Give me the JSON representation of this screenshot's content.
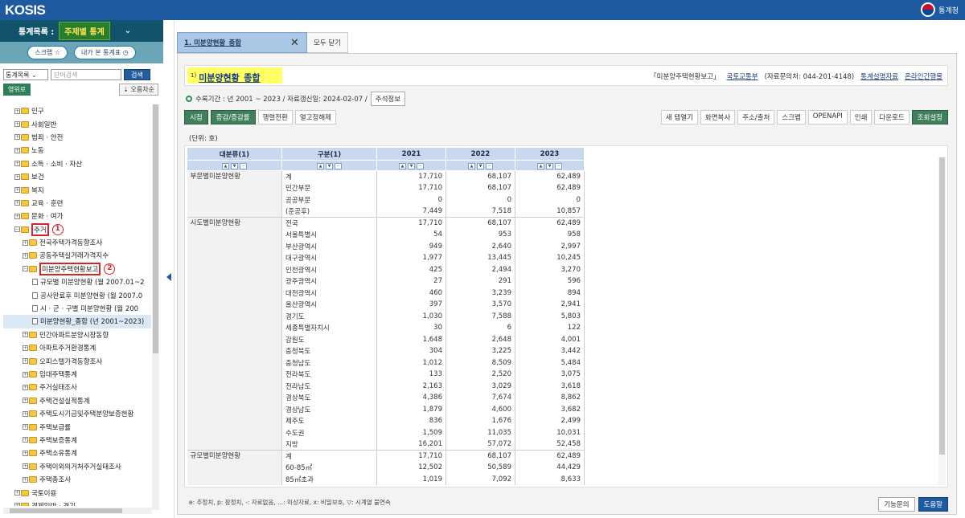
{
  "header": {
    "logo": "KOSIS",
    "org": "통계청"
  },
  "left": {
    "list_label": "통계목록 :",
    "list_select": "주제별 통계",
    "scrap": "스크랩 ☆",
    "my_table": "내가 본 통계표 ◷",
    "search_select": "통계목록",
    "search_placeholder": "단어검색",
    "search_btn": "검색",
    "roman": "영위로",
    "sort": "오름차순",
    "tree": [
      {
        "t": "인구",
        "lvl": 1
      },
      {
        "t": "사회일반",
        "lvl": 1
      },
      {
        "t": "범죄 · 안전",
        "lvl": 1
      },
      {
        "t": "노동",
        "lvl": 1
      },
      {
        "t": "소득 · 소비 · 자산",
        "lvl": 1
      },
      {
        "t": "보건",
        "lvl": 1
      },
      {
        "t": "복지",
        "lvl": 1
      },
      {
        "t": "교육 · 훈련",
        "lvl": 1
      },
      {
        "t": "문화 · 여가",
        "lvl": 1
      },
      {
        "t": "주거",
        "lvl": 1,
        "hl": "1"
      },
      {
        "t": "전국주택가격동향조사",
        "lvl": 2
      },
      {
        "t": "공동주택실거래가격지수",
        "lvl": 2
      },
      {
        "t": "미분양주택현황보고",
        "lvl": 2,
        "hl": "2"
      },
      {
        "t": "규모별 미분양현황 (월 2007.01~2",
        "lvl": 3,
        "doc": true
      },
      {
        "t": "공사완료후 미분양현황 (월 2007.0",
        "lvl": 3,
        "doc": true
      },
      {
        "t": "시 · 군 · 구별 미분양현황 (월 200",
        "lvl": 3,
        "doc": true
      },
      {
        "t": "미분양현황_종합 (년 2001~2023)",
        "lvl": 3,
        "doc": true,
        "sel": true
      },
      {
        "t": "민간아파트분양시장동향",
        "lvl": 2
      },
      {
        "t": "아파트주거환경통계",
        "lvl": 2
      },
      {
        "t": "오피스텔가격동향조사",
        "lvl": 2
      },
      {
        "t": "임대주택통계",
        "lvl": 2
      },
      {
        "t": "주거실태조사",
        "lvl": 2
      },
      {
        "t": "주택건설실적통계",
        "lvl": 2
      },
      {
        "t": "주택도시기금및주택분양보증현황",
        "lvl": 2
      },
      {
        "t": "주택보급률",
        "lvl": 2
      },
      {
        "t": "주택보증통계",
        "lvl": 2
      },
      {
        "t": "주택소유통계",
        "lvl": 2
      },
      {
        "t": "주택이외의거처주거실태조사",
        "lvl": 2
      },
      {
        "t": "주택총조사",
        "lvl": 2
      },
      {
        "t": "국토이용",
        "lvl": 1
      },
      {
        "t": "경제일반 · 경기",
        "lvl": 1
      }
    ]
  },
  "tabs": {
    "active": "1. 미분양현황_종합",
    "close_all": "모두 닫기"
  },
  "title": {
    "num": "1)",
    "text": "미분양현황_종합",
    "report": "「미분양주택현황보고」",
    "dept": "국토교통부",
    "contact": "(자료문의처: 044-201-4148)",
    "desc_link": "통계설명자료",
    "online_link": "온라인간행물"
  },
  "period": {
    "text": "수록기간 : 년 2001 ~ 2023 / 자료갱신일: 2024-02-07 /",
    "note_btn": "주석정보"
  },
  "toolbar": {
    "left": [
      "시점",
      "증감/증감률",
      "행렬전환",
      "열고정해제"
    ],
    "right": [
      "새 탭열기",
      "화면복사",
      "주소/출처",
      "스크랩",
      "OPENAPI",
      "인쇄",
      "다운로드",
      "조회설정"
    ]
  },
  "unit": "(단위: 호)",
  "table": {
    "headers": [
      "대분류(1)",
      "구분(1)",
      "2021",
      "2022",
      "2023"
    ],
    "rows": [
      [
        "부문별미분양현황",
        "계",
        "17,710",
        "68,107",
        "62,489"
      ],
      [
        "",
        "민간부문",
        "17,710",
        "68,107",
        "62,489"
      ],
      [
        "",
        "공공부문",
        "0",
        "0",
        "0"
      ],
      [
        "",
        "(준공후)",
        "7,449",
        "7,518",
        "10,857"
      ],
      [
        "시도별미분양현황",
        "전국",
        "17,710",
        "68,107",
        "62,489"
      ],
      [
        "",
        "서울특별시",
        "54",
        "953",
        "958"
      ],
      [
        "",
        "부산광역시",
        "949",
        "2,640",
        "2,997"
      ],
      [
        "",
        "대구광역시",
        "1,977",
        "13,445",
        "10,245"
      ],
      [
        "",
        "인천광역시",
        "425",
        "2,494",
        "3,270"
      ],
      [
        "",
        "광주광역시",
        "27",
        "291",
        "596"
      ],
      [
        "",
        "대전광역시",
        "460",
        "3,239",
        "894"
      ],
      [
        "",
        "울산광역시",
        "397",
        "3,570",
        "2,941"
      ],
      [
        "",
        "경기도",
        "1,030",
        "7,588",
        "5,803"
      ],
      [
        "",
        "세종특별자치시",
        "30",
        "6",
        "122"
      ],
      [
        "",
        "강원도",
        "1,648",
        "2,648",
        "4,001"
      ],
      [
        "",
        "충청북도",
        "304",
        "3,225",
        "3,442"
      ],
      [
        "",
        "충청남도",
        "1,012",
        "8,509",
        "5,484"
      ],
      [
        "",
        "전라북도",
        "133",
        "2,520",
        "3,075"
      ],
      [
        "",
        "전라남도",
        "2,163",
        "3,029",
        "3,618"
      ],
      [
        "",
        "경상북도",
        "4,386",
        "7,674",
        "8,862"
      ],
      [
        "",
        "경상남도",
        "1,879",
        "4,600",
        "3,682"
      ],
      [
        "",
        "제주도",
        "836",
        "1,676",
        "2,499"
      ],
      [
        "",
        "수도권",
        "1,509",
        "11,035",
        "10,031"
      ],
      [
        "",
        "지방",
        "16,201",
        "57,072",
        "52,458"
      ],
      [
        "규모별미분양현황",
        "계",
        "17,710",
        "68,107",
        "62,489"
      ],
      [
        "",
        "60-85㎡",
        "12,502",
        "50,589",
        "44,429"
      ],
      [
        "",
        "85㎡초과",
        "1,019",
        "7,092",
        "8,633"
      ]
    ]
  },
  "legend": "e: 추정치, p: 잠정치, -: 자료없음, ...: 미상자료, x: 비밀보호, ▽: 시계열 불연속",
  "help": {
    "func": "기능문의",
    "help": "도움말"
  }
}
